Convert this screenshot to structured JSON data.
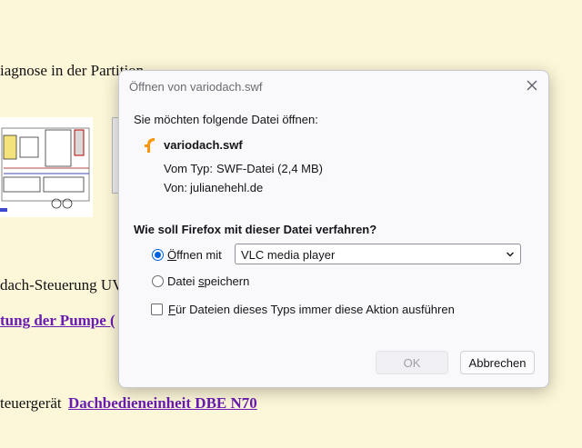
{
  "background": {
    "line1": "iagnose in der Partition",
    "line2": "dach-Steuerung UV",
    "link1": "tung der Pumpe (",
    "line3": "teuergerät",
    "link2": "Dachbedieneinheit DBE N70",
    "link_color": "#6a1bb1",
    "page_color": "#fdf7d9"
  },
  "dialog": {
    "title": "Öffnen von variodach.swf",
    "intro": "Sie möchten folgende Datei öffnen:",
    "filename": "variodach.swf",
    "type_label": "Vom Typ:",
    "type_value": "SWF-Datei (2,4 MB)",
    "from_label": "Von:",
    "from_value": "julianehehl.de",
    "question": "Wie soll Firefox mit dieser Datei verfahren?",
    "open_with": {
      "accel": "Ö",
      "rest": "ffnen mit",
      "checked": true
    },
    "app_select": {
      "value": "VLC media player"
    },
    "save_file": {
      "before": "Datei ",
      "accel": "s",
      "after": "peichern",
      "checked": false
    },
    "always": {
      "accel": "F",
      "rest": "ür Dateien dieses Typs immer diese Aktion ausführen",
      "checked": false
    },
    "ok_label": "OK",
    "cancel_label": "Abbrechen",
    "accent_color": "#0061e0",
    "file_icon_color": "#ff9500"
  }
}
